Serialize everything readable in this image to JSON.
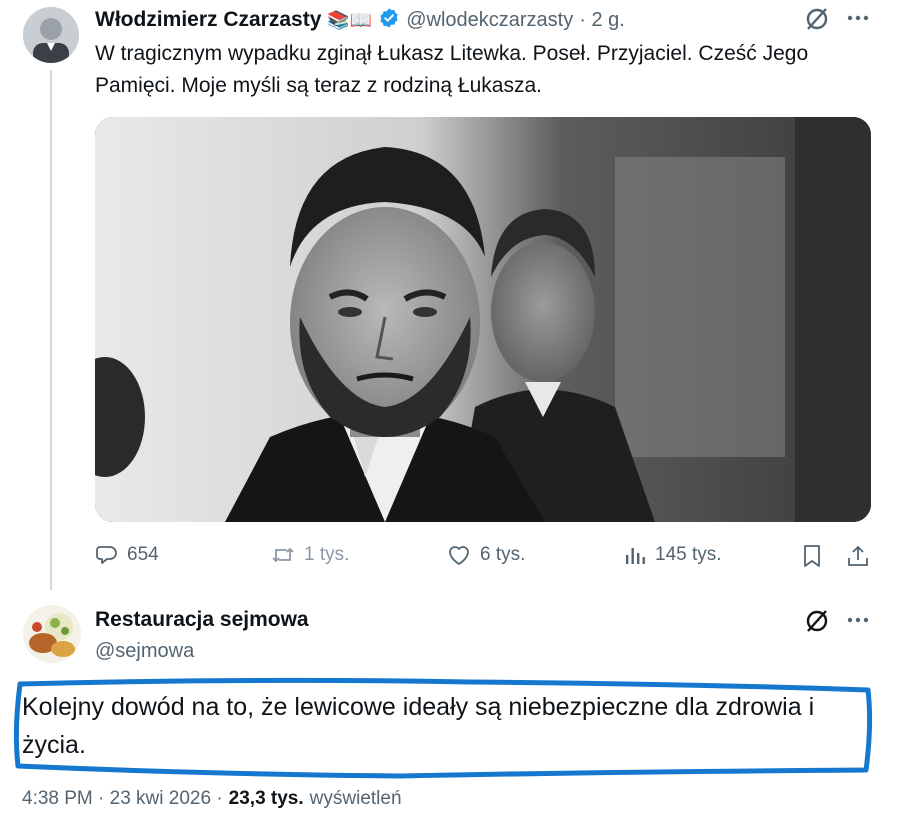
{
  "tweet1": {
    "author_name": "Włodzimierz Czarzasty",
    "author_emoji": "📚📖",
    "handle": "@wlodekczarzasty",
    "time": "· 2 g.",
    "text_line1": "W tragicznym wypadku zginął Łukasz Litewka. Poseł. Przyjaciel. Cześć Jego",
    "text_line2": "Pamięci. Moje myśli są teraz z rodziną Łukasza.",
    "stats": {
      "replies": "654",
      "reposts": "1 tys.",
      "likes": "6 tys.",
      "views": "145 tys."
    }
  },
  "tweet2": {
    "author_name": "Restauracja sejmowa",
    "handle": "@sejmowa",
    "text_line1": "Kolejny dowód na to, że lewicowe ideały są niebezpieczne dla zdrowia i",
    "text_line2": "życia.",
    "timestamp": "4:38 PM · 23 kwi 2026 ·",
    "views_count": "23,3 tys.",
    "views_label": "wyświetleń"
  },
  "colors": {
    "accent": "#1d9bf0",
    "highlight": "#1677cf",
    "muted": "#536471"
  }
}
